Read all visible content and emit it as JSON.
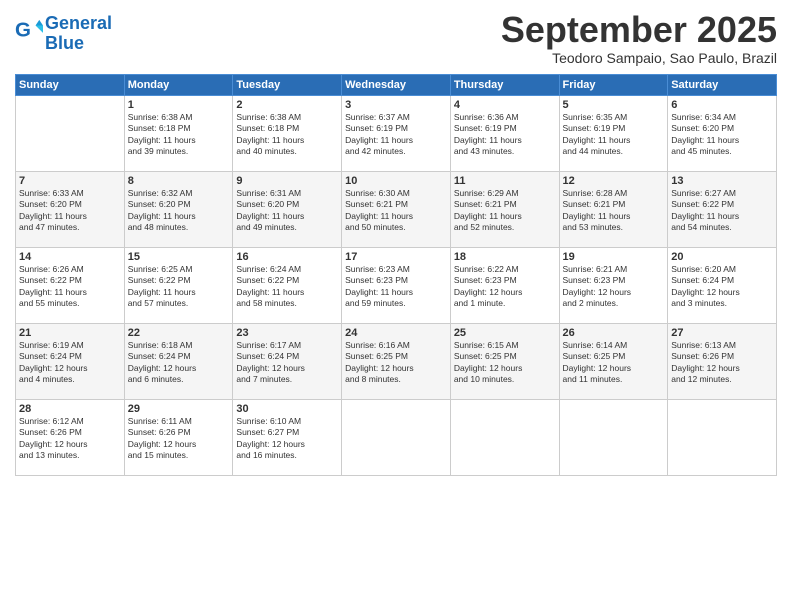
{
  "header": {
    "logo_line1": "General",
    "logo_line2": "Blue",
    "month": "September 2025",
    "location": "Teodoro Sampaio, Sao Paulo, Brazil"
  },
  "days_of_week": [
    "Sunday",
    "Monday",
    "Tuesday",
    "Wednesday",
    "Thursday",
    "Friday",
    "Saturday"
  ],
  "weeks": [
    [
      {
        "day": "",
        "info": ""
      },
      {
        "day": "1",
        "info": "Sunrise: 6:38 AM\nSunset: 6:18 PM\nDaylight: 11 hours\nand 39 minutes."
      },
      {
        "day": "2",
        "info": "Sunrise: 6:38 AM\nSunset: 6:18 PM\nDaylight: 11 hours\nand 40 minutes."
      },
      {
        "day": "3",
        "info": "Sunrise: 6:37 AM\nSunset: 6:19 PM\nDaylight: 11 hours\nand 42 minutes."
      },
      {
        "day": "4",
        "info": "Sunrise: 6:36 AM\nSunset: 6:19 PM\nDaylight: 11 hours\nand 43 minutes."
      },
      {
        "day": "5",
        "info": "Sunrise: 6:35 AM\nSunset: 6:19 PM\nDaylight: 11 hours\nand 44 minutes."
      },
      {
        "day": "6",
        "info": "Sunrise: 6:34 AM\nSunset: 6:20 PM\nDaylight: 11 hours\nand 45 minutes."
      }
    ],
    [
      {
        "day": "7",
        "info": "Sunrise: 6:33 AM\nSunset: 6:20 PM\nDaylight: 11 hours\nand 47 minutes."
      },
      {
        "day": "8",
        "info": "Sunrise: 6:32 AM\nSunset: 6:20 PM\nDaylight: 11 hours\nand 48 minutes."
      },
      {
        "day": "9",
        "info": "Sunrise: 6:31 AM\nSunset: 6:20 PM\nDaylight: 11 hours\nand 49 minutes."
      },
      {
        "day": "10",
        "info": "Sunrise: 6:30 AM\nSunset: 6:21 PM\nDaylight: 11 hours\nand 50 minutes."
      },
      {
        "day": "11",
        "info": "Sunrise: 6:29 AM\nSunset: 6:21 PM\nDaylight: 11 hours\nand 52 minutes."
      },
      {
        "day": "12",
        "info": "Sunrise: 6:28 AM\nSunset: 6:21 PM\nDaylight: 11 hours\nand 53 minutes."
      },
      {
        "day": "13",
        "info": "Sunrise: 6:27 AM\nSunset: 6:22 PM\nDaylight: 11 hours\nand 54 minutes."
      }
    ],
    [
      {
        "day": "14",
        "info": "Sunrise: 6:26 AM\nSunset: 6:22 PM\nDaylight: 11 hours\nand 55 minutes."
      },
      {
        "day": "15",
        "info": "Sunrise: 6:25 AM\nSunset: 6:22 PM\nDaylight: 11 hours\nand 57 minutes."
      },
      {
        "day": "16",
        "info": "Sunrise: 6:24 AM\nSunset: 6:22 PM\nDaylight: 11 hours\nand 58 minutes."
      },
      {
        "day": "17",
        "info": "Sunrise: 6:23 AM\nSunset: 6:23 PM\nDaylight: 11 hours\nand 59 minutes."
      },
      {
        "day": "18",
        "info": "Sunrise: 6:22 AM\nSunset: 6:23 PM\nDaylight: 12 hours\nand 1 minute."
      },
      {
        "day": "19",
        "info": "Sunrise: 6:21 AM\nSunset: 6:23 PM\nDaylight: 12 hours\nand 2 minutes."
      },
      {
        "day": "20",
        "info": "Sunrise: 6:20 AM\nSunset: 6:24 PM\nDaylight: 12 hours\nand 3 minutes."
      }
    ],
    [
      {
        "day": "21",
        "info": "Sunrise: 6:19 AM\nSunset: 6:24 PM\nDaylight: 12 hours\nand 4 minutes."
      },
      {
        "day": "22",
        "info": "Sunrise: 6:18 AM\nSunset: 6:24 PM\nDaylight: 12 hours\nand 6 minutes."
      },
      {
        "day": "23",
        "info": "Sunrise: 6:17 AM\nSunset: 6:24 PM\nDaylight: 12 hours\nand 7 minutes."
      },
      {
        "day": "24",
        "info": "Sunrise: 6:16 AM\nSunset: 6:25 PM\nDaylight: 12 hours\nand 8 minutes."
      },
      {
        "day": "25",
        "info": "Sunrise: 6:15 AM\nSunset: 6:25 PM\nDaylight: 12 hours\nand 10 minutes."
      },
      {
        "day": "26",
        "info": "Sunrise: 6:14 AM\nSunset: 6:25 PM\nDaylight: 12 hours\nand 11 minutes."
      },
      {
        "day": "27",
        "info": "Sunrise: 6:13 AM\nSunset: 6:26 PM\nDaylight: 12 hours\nand 12 minutes."
      }
    ],
    [
      {
        "day": "28",
        "info": "Sunrise: 6:12 AM\nSunset: 6:26 PM\nDaylight: 12 hours\nand 13 minutes."
      },
      {
        "day": "29",
        "info": "Sunrise: 6:11 AM\nSunset: 6:26 PM\nDaylight: 12 hours\nand 15 minutes."
      },
      {
        "day": "30",
        "info": "Sunrise: 6:10 AM\nSunset: 6:27 PM\nDaylight: 12 hours\nand 16 minutes."
      },
      {
        "day": "",
        "info": ""
      },
      {
        "day": "",
        "info": ""
      },
      {
        "day": "",
        "info": ""
      },
      {
        "day": "",
        "info": ""
      }
    ]
  ]
}
